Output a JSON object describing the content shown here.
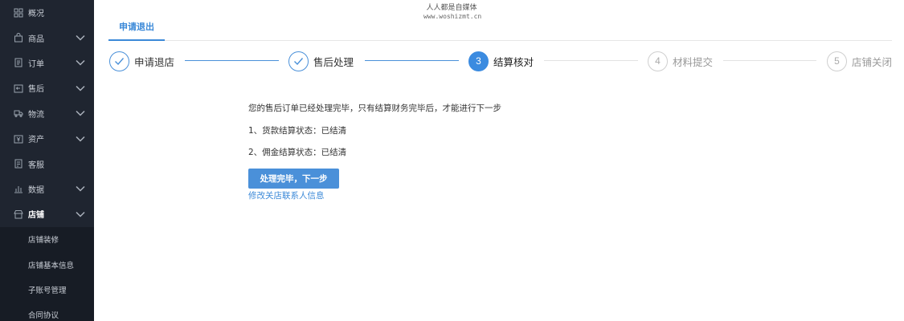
{
  "sidebar": {
    "items": [
      {
        "label": "概况",
        "icon": "grid-icon",
        "has_chevron": false
      },
      {
        "label": "商品",
        "icon": "bag-icon",
        "has_chevron": true
      },
      {
        "label": "订单",
        "icon": "document-icon",
        "has_chevron": true
      },
      {
        "label": "售后",
        "icon": "return-box-icon",
        "has_chevron": true
      },
      {
        "label": "物流",
        "icon": "truck-icon",
        "has_chevron": true
      },
      {
        "label": "资产",
        "icon": "wallet-icon",
        "has_chevron": true
      },
      {
        "label": "客服",
        "icon": "service-icon",
        "has_chevron": false
      },
      {
        "label": "数据",
        "icon": "bar-chart-icon",
        "has_chevron": true
      },
      {
        "label": "店铺",
        "icon": "store-icon",
        "has_chevron": true
      }
    ],
    "submenu": [
      "店铺装修",
      "店铺基本信息",
      "子账号管理",
      "合同协议"
    ]
  },
  "watermark": {
    "line1": "人人都是自媒体",
    "line2": "www.woshizmt.cn"
  },
  "tab": {
    "label": "申请退出"
  },
  "steps": [
    {
      "label": "申请退店",
      "number": "",
      "state": "done"
    },
    {
      "label": "售后处理",
      "number": "",
      "state": "done"
    },
    {
      "label": "结算核对",
      "number": "3",
      "state": "current"
    },
    {
      "label": "材料提交",
      "number": "4",
      "state": "todo"
    },
    {
      "label": "店铺关闭",
      "number": "5",
      "state": "todo"
    }
  ],
  "content": {
    "intro": "您的售后订单已经处理完毕，只有结算财务完毕后，才能进行下一步",
    "payment_status": "1、货款结算状态：已结清",
    "commission_status": "2、佣金结算状态：已结清",
    "next_button": "处理完毕，下一步",
    "edit_link": "修改关店联系人信息"
  },
  "colors": {
    "sidebar_bg": "#1f2530",
    "accent": "#3b89d8",
    "primary_button": "#4a90d9"
  }
}
